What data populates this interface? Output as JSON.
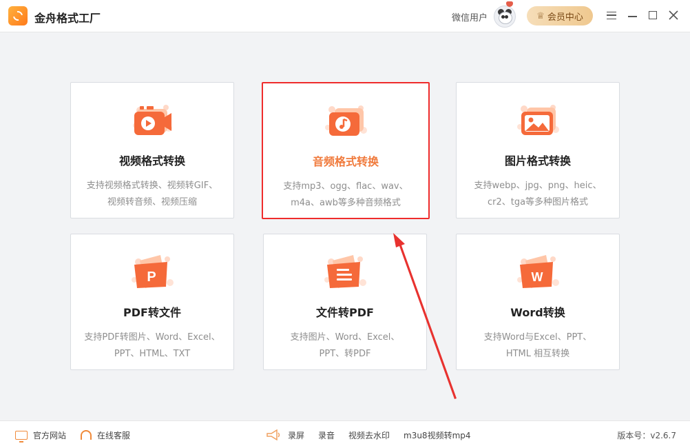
{
  "app": {
    "title": "金舟格式工厂"
  },
  "header": {
    "user_name": "微信用户",
    "vip_label": "会员中心"
  },
  "cards": [
    {
      "title": "视频格式转换",
      "desc": [
        "支持视频格式转换、视频转GIF、",
        "视频转音频、视频压缩"
      ],
      "icon": "video-icon",
      "selected": false
    },
    {
      "title": "音频格式转换",
      "desc": [
        "支持mp3、ogg、flac、wav、",
        "m4a、awb等多种音频格式"
      ],
      "icon": "audio-icon",
      "selected": true
    },
    {
      "title": "图片格式转换",
      "desc": [
        "支持webp、jpg、png、heic、",
        "cr2、tga等多种图片格式"
      ],
      "icon": "image-icon",
      "selected": false
    },
    {
      "title": "PDF转文件",
      "desc": [
        "支持PDF转图片、Word、Excel、",
        "PPT、HTML、TXT"
      ],
      "icon": "pdf-icon",
      "selected": false,
      "glyph": "P"
    },
    {
      "title": "文件转PDF",
      "desc": [
        "支持图片、Word、Excel、",
        "PPT、转PDF"
      ],
      "icon": "document-icon",
      "selected": false
    },
    {
      "title": "Word转换",
      "desc": [
        "支持Word与Excel、PPT、",
        "HTML 相互转换"
      ],
      "icon": "word-icon",
      "selected": false,
      "glyph": "W"
    }
  ],
  "footer": {
    "website": "官方网站",
    "service": "在线客服",
    "record_screen": "录屏",
    "record_audio": "录音",
    "remove_watermark": "视频去水印",
    "m3u8": "m3u8视频转mp4",
    "version": "版本号：v2.6.7"
  },
  "colors": {
    "accent": "#f07a3c",
    "highlight_border": "#ef2b2b",
    "vip_gold": "#efc88f",
    "annotation_arrow": "#e8322f"
  }
}
